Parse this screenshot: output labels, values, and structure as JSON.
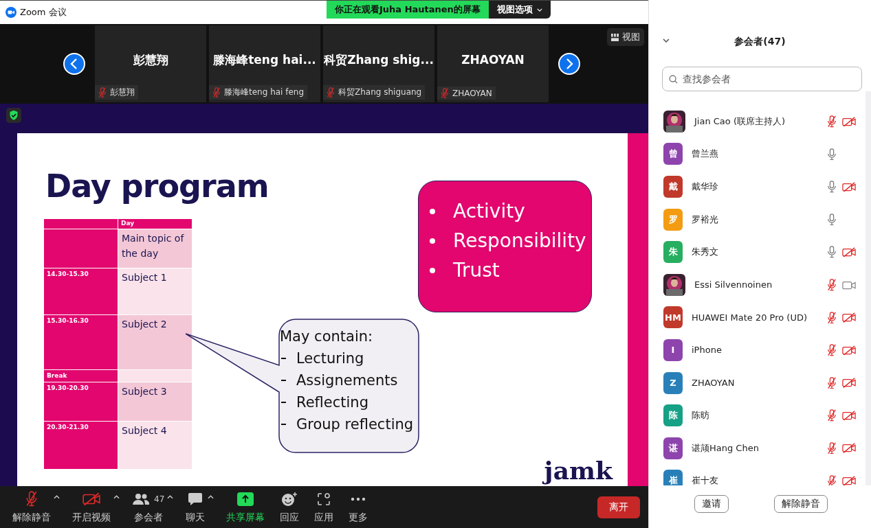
{
  "window": {
    "title": "Zoom 会议"
  },
  "share_banner": {
    "text": "你正在观看Juha Hautanen的屏幕",
    "options": "视图选项"
  },
  "gallery": {
    "view_button": "视图",
    "tiles": [
      {
        "big_name": "彭慧翔",
        "label": "彭慧翔",
        "muted": true
      },
      {
        "big_name": "滕海峰teng hai...",
        "label": "滕海峰teng hai feng",
        "muted": true
      },
      {
        "big_name": "科贸Zhang shig...",
        "label": "科贸Zhang shiguang",
        "muted": true
      },
      {
        "big_name": "ZHAOYAN",
        "label": "ZHAOYAN",
        "muted": true
      }
    ]
  },
  "slide": {
    "title": "Day program",
    "table": {
      "header": "Day",
      "rows": [
        {
          "topic": "Main topic of the day"
        },
        {
          "time": "14.30-15.30",
          "topic": "Subject 1"
        },
        {
          "time": "15.30-16.30",
          "topic": "Subject 2"
        },
        {
          "time": "Break"
        },
        {
          "time": "19.30-20.30",
          "topic": "Subject 3"
        },
        {
          "time": "20.30-21.30",
          "topic": "Subject 4"
        }
      ]
    },
    "values": [
      "Activity",
      "Responsibility",
      "Trust"
    ],
    "callout": {
      "heading": "May contain:",
      "items": [
        "Lecturing",
        "Assignements",
        "Reflecting",
        "Group reflecting"
      ]
    },
    "logo": "jamk"
  },
  "toolbar": [
    {
      "label": "解除静音",
      "kind": "mic",
      "caret": true
    },
    {
      "label": "开启视频",
      "kind": "video",
      "caret": true
    },
    {
      "label": "参会者",
      "kind": "people",
      "count": "47",
      "caret": true
    },
    {
      "label": "聊天",
      "kind": "chat",
      "caret": true
    },
    {
      "label": "共享屏幕",
      "kind": "share",
      "caret": false
    },
    {
      "label": "回应",
      "kind": "react",
      "caret": false
    },
    {
      "label": "应用",
      "kind": "apps",
      "caret": false
    },
    {
      "label": "更多",
      "kind": "more",
      "caret": false
    }
  ],
  "leave_button": "离开",
  "panel": {
    "title": "参会者(47)",
    "search": {
      "placeholder": "查找参会者"
    },
    "participants": [
      {
        "name": "Jian Cao (联席主持人)",
        "mic_muted": true,
        "video_off": true
      },
      {
        "name": "曾兰燕",
        "kind": "initials",
        "avatar": "曾",
        "color": "#8e44ad",
        "mic_muted": false
      },
      {
        "name": "戴华珍",
        "kind": "initials",
        "avatar": "戴",
        "color": "#c0392b",
        "mic_muted": false,
        "video_off": true
      },
      {
        "name": "罗裕光",
        "kind": "initials",
        "avatar": "罗",
        "color": "#f39c12",
        "mic_muted": false
      },
      {
        "name": "朱秀文",
        "kind": "initials",
        "avatar": "朱",
        "color": "#27ae60",
        "mic_muted": false,
        "video_off": true
      },
      {
        "name": "Essi Silvennoinen",
        "mic_muted": true,
        "video_off": false
      },
      {
        "name": "HUAWEI Mate 20 Pro (UD)",
        "kind": "initials",
        "avatar": "HM",
        "color": "#c0392b",
        "mic_muted": true,
        "video_off": true
      },
      {
        "name": "iPhone",
        "kind": "initials",
        "avatar": "I",
        "color": "#8e44ad",
        "mic_muted": true,
        "video_off": true
      },
      {
        "name": "ZHAOYAN",
        "kind": "initials",
        "avatar": "Z",
        "color": "#2980b9",
        "mic_muted": true,
        "video_off": true
      },
      {
        "name": "陈昉",
        "kind": "initials",
        "avatar": "陈",
        "color": "#16a085",
        "mic_muted": true,
        "video_off": true
      },
      {
        "name": "谌颃Hang Chen",
        "kind": "initials",
        "avatar": "谌",
        "color": "#8e44ad",
        "mic_muted": true,
        "video_off": true
      },
      {
        "name": "崔十友",
        "kind": "initials",
        "avatar": "崔",
        "color": "#2980b9",
        "mic_muted": true,
        "video_off": true
      }
    ],
    "buttons": [
      "邀请",
      "解除静音"
    ]
  }
}
